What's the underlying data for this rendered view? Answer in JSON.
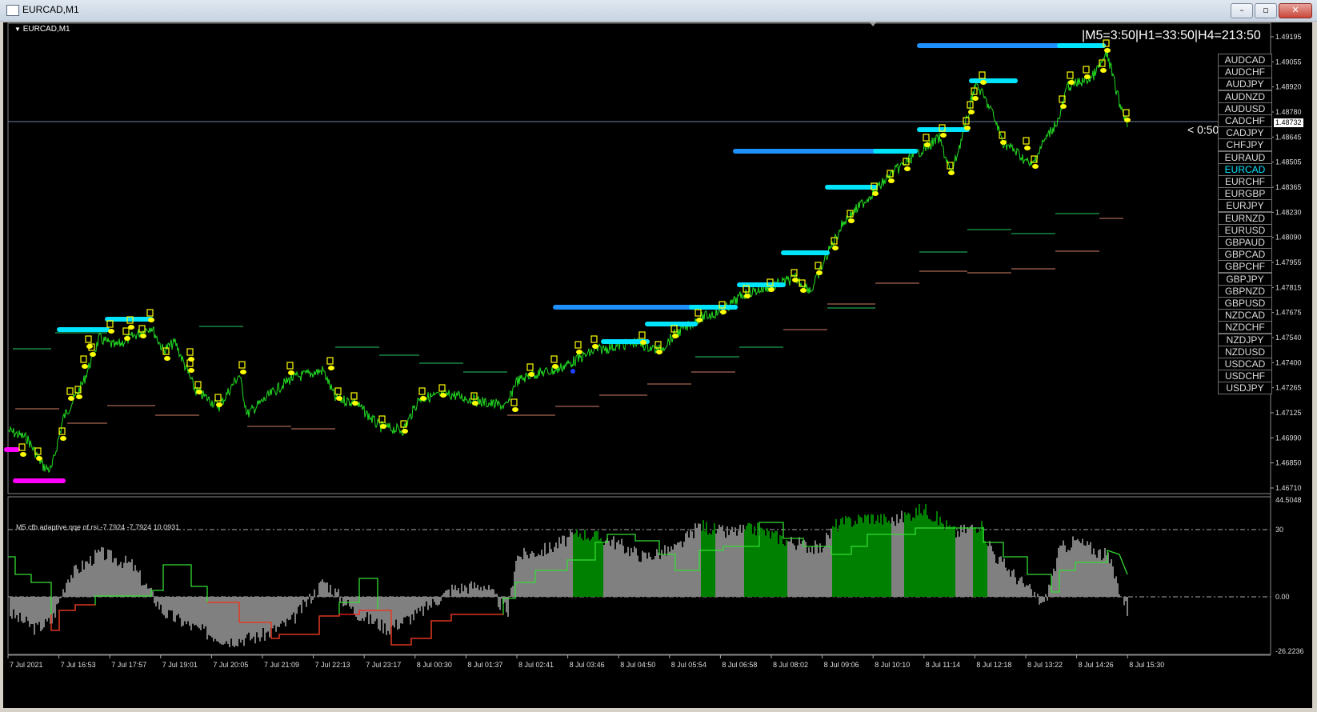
{
  "window": {
    "title": "EURCAD,M1",
    "min": "–",
    "max": "▫",
    "close": "✕"
  },
  "chart": {
    "label": "EURCAD,M1",
    "timer": "|M5=3:50|H1=33:50|H4=213:50",
    "countdown": "< 0:50",
    "current_price": "1.48732",
    "price_ticks": [
      "1.49195",
      "1.49055",
      "1.48920",
      "1.48780",
      "1.48645",
      "1.48505",
      "1.48365",
      "1.48230",
      "1.48090",
      "1.47955",
      "1.47815",
      "1.47675",
      "1.47540",
      "1.47400",
      "1.47265",
      "1.47125",
      "1.46990",
      "1.46850",
      "1.46710"
    ],
    "time_ticks": [
      "7 Jul 2021",
      "7 Jul 16:53",
      "7 Jul 17:57",
      "7 Jul 19:01",
      "7 Jul 20:05",
      "7 Jul 21:09",
      "7 Jul 22:13",
      "7 Jul 23:17",
      "8 Jul 00:30",
      "8 Jul 01:37",
      "8 Jul 02:41",
      "8 Jul 03:46",
      "8 Jul 04:50",
      "8 Jul 05:54",
      "8 Jul 06:58",
      "8 Jul 08:02",
      "8 Jul 09:06",
      "8 Jul 10:10",
      "8 Jul 11:14",
      "8 Jul 12:18",
      "8 Jul 13:22",
      "8 Jul 14:26",
      "8 Jul 15:30"
    ]
  },
  "indicator": {
    "label": "M5  cfb adaptive qqe of rsi -7.7924 -7.7924 10.0931",
    "ticks": [
      "44.5048",
      "30",
      "0.00",
      "-26.2236"
    ]
  },
  "symbols": [
    "AUDCAD",
    "AUDCHF",
    "AUDJPY",
    "AUDNZD",
    "AUDUSD",
    "CADCHF",
    "CADJPY",
    "CHFJPY",
    "EURAUD",
    "EURCAD",
    "EURCHF",
    "EURGBP",
    "EURJPY",
    "EURNZD",
    "EURUSD",
    "GBPAUD",
    "GBPCAD",
    "GBPCHF",
    "GBPJPY",
    "GBPNZD",
    "GBPUSD",
    "NZDCAD",
    "NZDCHF",
    "NZDJPY",
    "NZDUSD",
    "USDCAD",
    "USDCHF",
    "USDJPY"
  ],
  "active_symbol": "EURCAD",
  "colors": {
    "price_line": "#22dd22",
    "signal": "#ffff00",
    "blue_level": "#1e90ff",
    "cyan_level": "#00e5ff",
    "histogram_gray": "#808080",
    "histogram_green": "#008000",
    "qqe_red": "#ff2020",
    "qqe_green": "#33dd33"
  }
}
